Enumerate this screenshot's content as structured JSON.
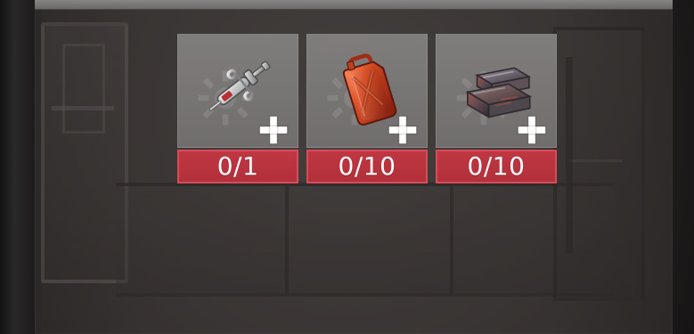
{
  "inventory": {
    "slots": [
      {
        "icon": "syringe-icon",
        "count": "0/1"
      },
      {
        "icon": "fuel-canister-icon",
        "count": "0/10"
      },
      {
        "icon": "metal-ingot-icon",
        "count": "0/10"
      }
    ]
  },
  "colors": {
    "badge": "#bf3742",
    "badge_border": "#d74c58",
    "tile": "#828080",
    "plus": "#ffffff",
    "overlay": "#45403f"
  }
}
